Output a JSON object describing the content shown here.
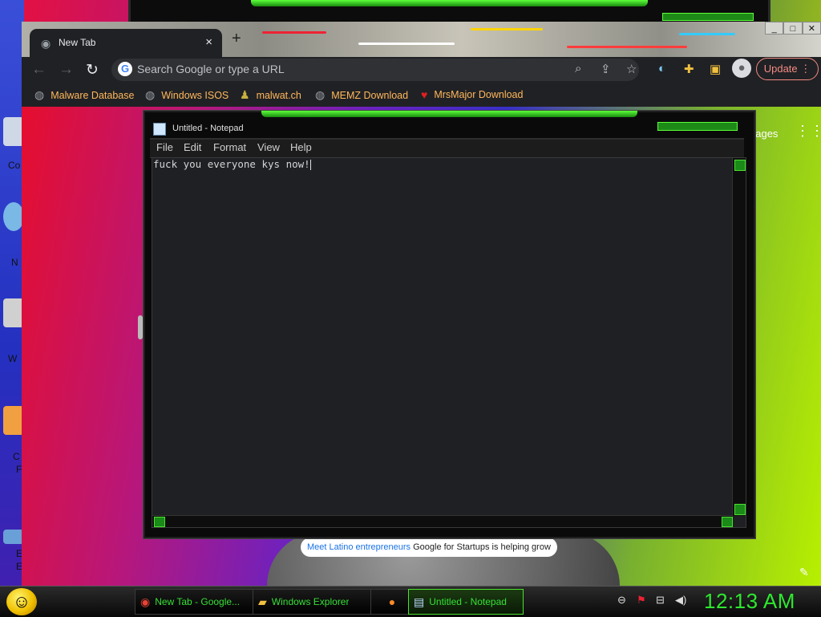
{
  "desktop": {
    "icon_labels": [
      "Co",
      "N",
      "W",
      "C",
      "F",
      "E",
      "E"
    ]
  },
  "chrome": {
    "tab_title": "New Tab",
    "tab_close": "×",
    "new_tab": "+",
    "window_controls": [
      "_",
      "□",
      "✕"
    ],
    "omnibox_placeholder": "Search Google or type a URL",
    "update_label": "Update",
    "bookmarks": [
      {
        "label": "Malware Database",
        "icon": "globe-icon"
      },
      {
        "label": "Windows ISOS",
        "icon": "globe-icon"
      },
      {
        "label": "malwat.ch",
        "icon": "person-icon"
      },
      {
        "label": "MEMZ Download",
        "icon": "globe-icon"
      },
      {
        "label": "MrsMajor Download",
        "icon": "heart-icon"
      }
    ],
    "page": {
      "images_link": "nages",
      "promo_link": "Meet Latino entrepreneurs",
      "promo_text": " Google for Startups is helping grow"
    }
  },
  "notepad": {
    "title": "Untitled - Notepad",
    "menu": [
      "File",
      "Edit",
      "Format",
      "View",
      "Help"
    ],
    "text": "fuck you everyone kys now!"
  },
  "taskbar": {
    "buttons": [
      {
        "label": "New Tab - Google...",
        "icon": "chrome-icon",
        "active": false
      },
      {
        "label": "Windows Explorer",
        "icon": "folder-icon",
        "active": false
      },
      {
        "label": "",
        "icon": "firefox-icon",
        "active": false
      },
      {
        "label": "Untitled - Notepad",
        "icon": "notepad-icon",
        "active": true
      }
    ],
    "clock": "12:13 AM"
  },
  "colors": {
    "accent_green": "#35e035",
    "bookmark_text": "#ffb85c",
    "update_red": "#f28b82"
  }
}
